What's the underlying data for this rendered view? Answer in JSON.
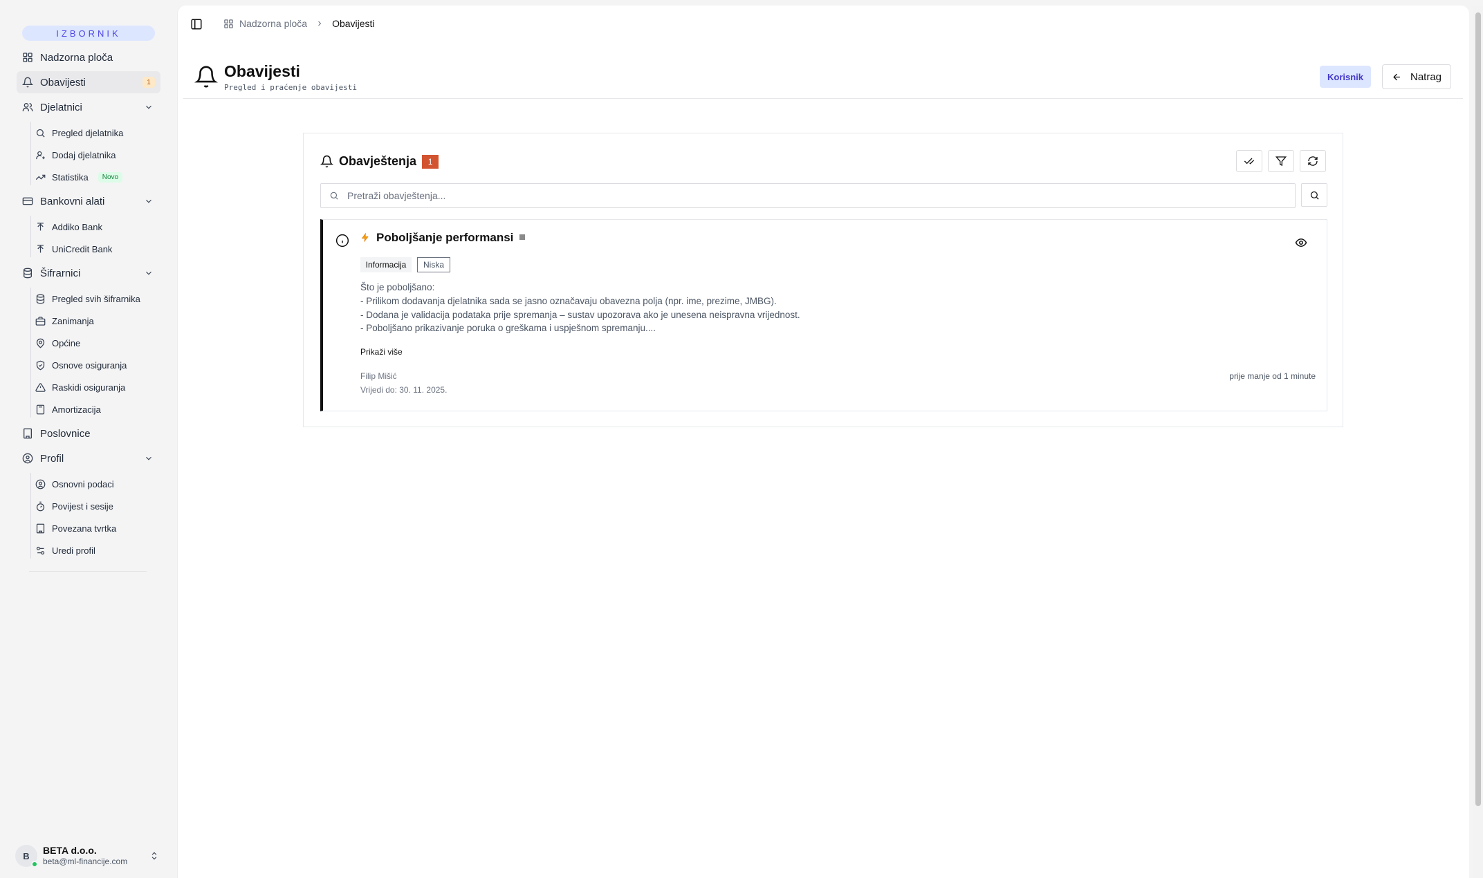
{
  "sidebar": {
    "section_title": "IZBORNIK",
    "items": {
      "dashboard": "Nadzorna ploča",
      "notifications": "Obavijesti",
      "notifications_badge": "1",
      "employees": "Djelatnici",
      "employees_sub": [
        "Pregled djelatnika",
        "Dodaj djelatnika",
        "Statistika"
      ],
      "statistics_badge": "Novo",
      "bank_tools": "Bankovni alati",
      "bank_tools_sub": [
        "Addiko Bank",
        "UniCredit Bank"
      ],
      "codebooks": "Šifrarnici",
      "codebooks_sub": [
        "Pregled svih šifrarnika",
        "Zanimanja",
        "Općine",
        "Osnove osiguranja",
        "Raskidi osiguranja",
        "Amortizacija"
      ],
      "offices": "Poslovnice",
      "profile": "Profil",
      "profile_sub": [
        "Osnovni podaci",
        "Povijest i sesije",
        "Povezana tvrtka",
        "Uredi profil"
      ]
    },
    "account": {
      "initial": "B",
      "name": "BETA d.o.o.",
      "email": "beta@ml-financije.com"
    }
  },
  "breadcrumb": {
    "root": "Nadzorna ploča",
    "current": "Obavijesti"
  },
  "header": {
    "title": "Obavijesti",
    "subtitle": "Pregled i praćenje obavijesti",
    "role": "Korisnik",
    "back_label": "Natrag"
  },
  "notifications_panel": {
    "title": "Obavještenja",
    "count": "1",
    "search_placeholder": "Pretraži obavještenja...",
    "items": [
      {
        "title": "Poboljšanje performansi",
        "category": "Informacija",
        "priority": "Niska",
        "body": [
          "Što je poboljšano:",
          "- Prilikom dodavanja djelatnika sada se jasno označavaju obavezna polja (npr. ime, prezime, JMBG).",
          "- Dodana je validacija podataka prije spremanja – sustav upozorava ako je unesena neispravna vrijednost.",
          "- Poboljšano prikazivanje poruka o greškama i uspješnom spremanju...."
        ],
        "show_more": "Prikaži više",
        "author": "Filip Mišić",
        "valid_until": "Vrijedi do: 30. 11. 2025.",
        "relative_time": "prije manje od 1 minute"
      }
    ]
  },
  "colors": {
    "accent": "#4f46e5",
    "accent_bg": "#dde6ff",
    "count_badge": "#d2532f",
    "novo_bg": "#dcfce7",
    "novo_text": "#15803d",
    "online": "#22c55e"
  }
}
